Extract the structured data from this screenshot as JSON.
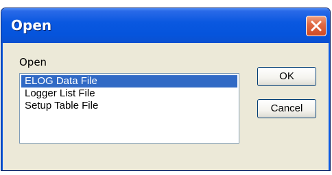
{
  "dialog": {
    "title": "Open",
    "label": "Open",
    "list_items": [
      {
        "label": "ELOG Data File",
        "selected": true
      },
      {
        "label": "Logger List File",
        "selected": false
      },
      {
        "label": "Setup Table File",
        "selected": false
      }
    ],
    "ok_label": "OK",
    "cancel_label": "Cancel",
    "close_icon": "close-icon"
  },
  "colors": {
    "titlebar": "#0554dc",
    "close_button": "#d04a24",
    "selection": "#316ac5",
    "dialog_face": "#ece9d8"
  }
}
